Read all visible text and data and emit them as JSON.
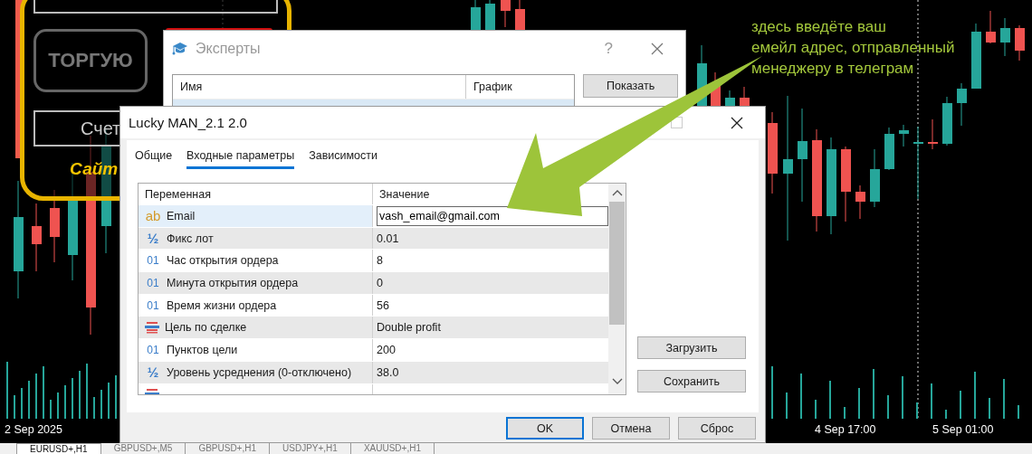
{
  "chart": {
    "time_labels": [
      "2 Sep 2025",
      "4 Sep 17:00",
      "5 Sep 01:00"
    ]
  },
  "overlay_panel": {
    "trade_button": "ТОРГУЮ",
    "account_label": "Счет",
    "site_label": "Сайт"
  },
  "experts_window": {
    "title": "Эксперты",
    "help": "?",
    "columns": [
      "Имя",
      "График"
    ],
    "show_button": "Показать"
  },
  "dialog": {
    "title": "Lucky MAN_2.1 2.0",
    "tabs": [
      {
        "label": "Общие",
        "selected": false
      },
      {
        "label": "Входные параметры",
        "selected": true
      },
      {
        "label": "Зависимости",
        "selected": false
      }
    ],
    "columns": [
      "Переменная",
      "Значение"
    ],
    "rows": [
      {
        "kind": "string",
        "icon": "ab",
        "name": "Email",
        "value": "vash_email@gmail.com",
        "selected": true
      },
      {
        "kind": "double",
        "icon": "½",
        "name": "Фикс лот",
        "value": "0.01",
        "selected": false
      },
      {
        "kind": "int",
        "icon": "01",
        "name": "Час открытия ордера",
        "value": "8",
        "selected": false
      },
      {
        "kind": "int",
        "icon": "01",
        "name": "Минута открытия ордера",
        "value": "0",
        "selected": false
      },
      {
        "kind": "int",
        "icon": "01",
        "name": "Время жизни ордера",
        "value": "56",
        "selected": false
      },
      {
        "kind": "enum",
        "name": "Цель по сделке",
        "value": "Double profit",
        "selected": false
      },
      {
        "kind": "int",
        "icon": "01",
        "name": "Пунктов цели",
        "value": "200",
        "selected": false
      },
      {
        "kind": "double",
        "icon": "½",
        "name": "Уровень усреднения (0-отключено)",
        "value": "38.0",
        "selected": false
      },
      {
        "kind": "enum",
        "selected": false
      }
    ],
    "side_buttons": [
      "Загрузить",
      "Сохранить"
    ],
    "footer_buttons": [
      {
        "label": "OK",
        "default": true
      },
      {
        "label": "Отмена",
        "default": false
      },
      {
        "label": "Сброс",
        "default": false
      }
    ]
  },
  "annotation": {
    "text": "здесь введёте ваш\nемейл адрес, отправленный\nменеджеру в телеграм"
  },
  "symbol_tabs": [
    {
      "label": "EURUSD+,H1",
      "selected": true
    },
    {
      "label": "GBPUSD+,M5",
      "selected": false
    },
    {
      "label": "GBPUSD+,H1",
      "selected": false
    },
    {
      "label": "USDJPY+,H1",
      "selected": false
    },
    {
      "label": "XAUUSD+,H1",
      "selected": false
    }
  ]
}
